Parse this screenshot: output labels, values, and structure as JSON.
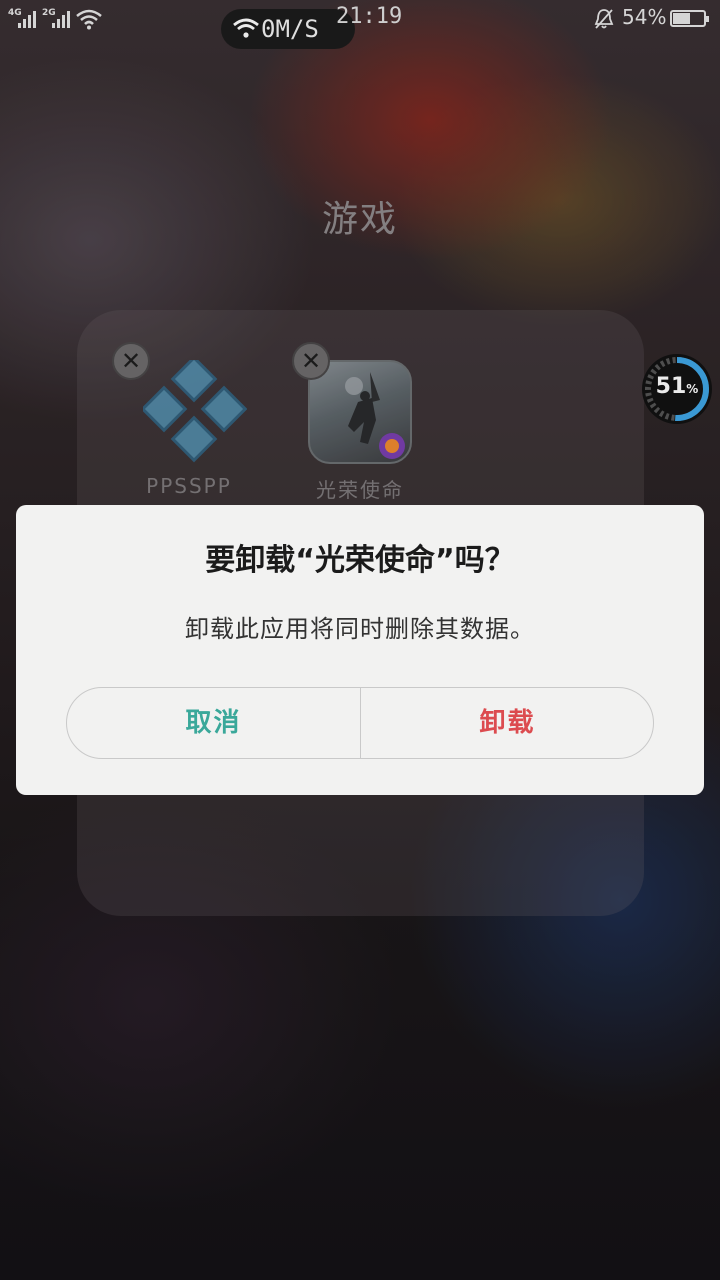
{
  "status_bar": {
    "sim1_label": "4G",
    "sim2_label": "2G",
    "net_speed": "0M/S",
    "time": "21:19",
    "battery_percent": "54%",
    "battery_level": 0.54
  },
  "folder": {
    "title": "游戏",
    "apps": [
      {
        "name": "PPSSPP"
      },
      {
        "name": "光荣使命"
      }
    ]
  },
  "speed_meter": {
    "value": "51",
    "unit": "%"
  },
  "dialog": {
    "title": "要卸载“光荣使命”吗？",
    "message": "卸载此应用将同时删除其数据。",
    "cancel_label": "取消",
    "uninstall_label": "卸载"
  },
  "colors": {
    "cancel": "#3aa89a",
    "uninstall": "#dc4b4f",
    "dialog_bg": "#f2f2f1"
  }
}
